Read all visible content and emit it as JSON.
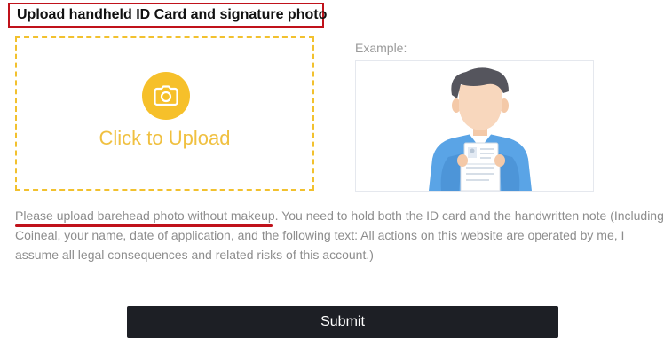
{
  "section": {
    "title": "Upload handheld ID Card and signature photo"
  },
  "upload": {
    "icon": "camera-icon",
    "label": "Click to Upload",
    "accent_color": "#f6c02a"
  },
  "example": {
    "label": "Example:",
    "illustration": "person-holding-id-card"
  },
  "note": {
    "highlight": "Please upload barehead photo without makeup.",
    "text": " You need to hold both the ID card and the handwritten note (Including Coineal, your name, date of application, and the following text: All actions on this website are operated by me, I assume all legal consequences and related risks of this account.)"
  },
  "submit": {
    "label": "Submit"
  }
}
